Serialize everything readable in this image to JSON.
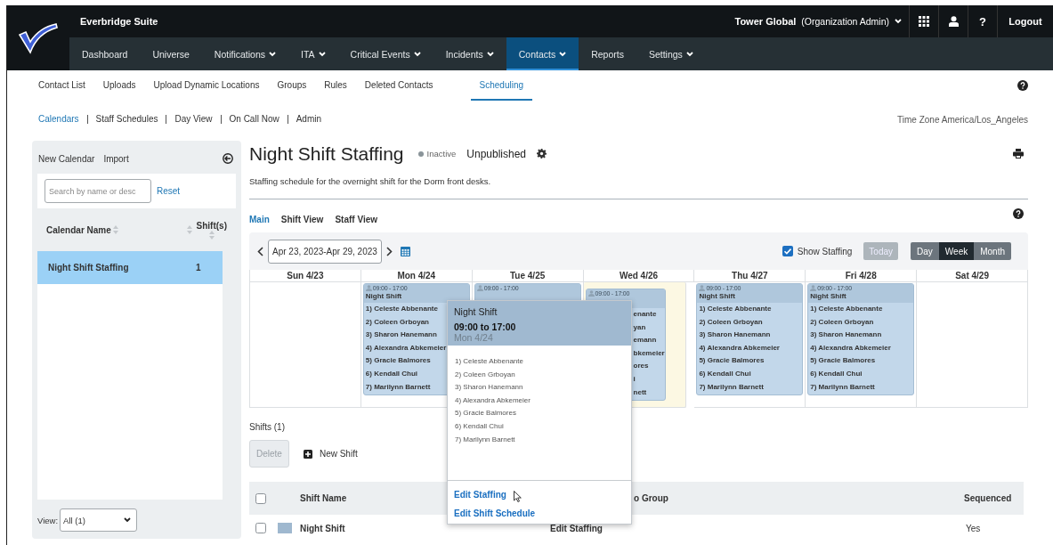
{
  "header": {
    "product": "Everbridge Suite",
    "organization": "Tower Global",
    "role": "(Organization Admin)",
    "help": "?",
    "logout": "Logout"
  },
  "nav": [
    {
      "label": "Dashboard",
      "menu": false,
      "selected": false
    },
    {
      "label": "Universe",
      "menu": false,
      "selected": false
    },
    {
      "label": "Notifications",
      "menu": true,
      "selected": false
    },
    {
      "label": "ITA",
      "menu": true,
      "selected": false
    },
    {
      "label": "Critical Events",
      "menu": true,
      "selected": false
    },
    {
      "label": "Incidents",
      "menu": true,
      "selected": false
    },
    {
      "label": "Contacts",
      "menu": true,
      "selected": true
    },
    {
      "label": "Reports",
      "menu": false,
      "selected": false
    },
    {
      "label": "Settings",
      "menu": true,
      "selected": false
    }
  ],
  "subnav": [
    {
      "label": "Contact List",
      "selected": false
    },
    {
      "label": "Uploads",
      "selected": false
    },
    {
      "label": "Upload Dynamic Locations",
      "selected": false
    },
    {
      "label": "Groups",
      "selected": false
    },
    {
      "label": "Rules",
      "selected": false
    },
    {
      "label": "Deleted Contacts",
      "selected": false
    },
    {
      "label": "Scheduling",
      "selected": true
    }
  ],
  "subtabs": [
    {
      "label": "Calendars",
      "selected": true
    },
    {
      "label": "Staff Schedules",
      "selected": false
    },
    {
      "label": "Day View",
      "selected": false
    },
    {
      "label": "On Call Now",
      "selected": false
    },
    {
      "label": "Admin",
      "selected": false
    }
  ],
  "timezone": "Time Zone America/Los_Angeles",
  "sidebar": {
    "actions": [
      "New Calendar",
      "Import"
    ],
    "search": {
      "placeholder": "Search by name or desc"
    },
    "reset": "Reset",
    "columns": [
      "Calendar Name",
      "Shift(s)"
    ],
    "rows": [
      {
        "name": "Night Shift Staffing",
        "shifts": "1",
        "selected": true
      }
    ],
    "view_label": "View:",
    "view_value": "All (1)"
  },
  "calendar": {
    "title": "Night Shift Staffing",
    "status": "Inactive",
    "publish": "Unpublished",
    "description": "Staffing schedule for the overnight shift for the Dorm front desks.",
    "tabs": [
      {
        "label": "Main",
        "selected": true
      },
      {
        "label": "Shift View",
        "selected": false
      },
      {
        "label": "Staff View",
        "selected": false
      }
    ],
    "date_range": "Apr 23, 2023-Apr 29, 2023",
    "show_staffing": {
      "label": "Show Staffing",
      "checked": true
    },
    "today_button": {
      "label": "Today",
      "disabled": true
    },
    "views": [
      {
        "label": "Day",
        "selected": false
      },
      {
        "label": "Week",
        "selected": true
      },
      {
        "label": "Month",
        "selected": false
      }
    ],
    "days": [
      {
        "label": "Sun 4/23",
        "today": false
      },
      {
        "label": "Mon 4/24",
        "today": false,
        "events": [
          {
            "kind": "full",
            "time": "09:00 - 17:00",
            "shift": "Night Shift",
            "staff": [
              "1) Celeste Abbenante",
              "2) Coleen Grboyan",
              "3) Sharon Hanemann",
              "4) Alexandra Abkemeier",
              "5) Gracie Balmores",
              "6) Kendall Chui",
              "7) Marilynn Barnett"
            ]
          }
        ]
      },
      {
        "label": "Tue 4/25",
        "today": false,
        "events": [
          {
            "kind": "partial",
            "time": "09:00 - 17:00"
          }
        ]
      },
      {
        "label": "Wed 4/26",
        "today": true,
        "events": [
          {
            "kind": "partial",
            "time": "09:00 - 17:00",
            "staff": [
              "enante",
              "yan",
              "emann",
              "bkemeier",
              "ores",
              "i",
              "nett"
            ]
          }
        ]
      },
      {
        "label": "Thu 4/27",
        "today": false,
        "events": [
          {
            "kind": "full",
            "time": "09:00 - 17:00",
            "shift": "Night Shift",
            "staff": [
              "1) Celeste Abbenante",
              "2) Coleen Grboyan",
              "3) Sharon Hanemann",
              "4) Alexandra Abkemeier",
              "5) Gracie Balmores",
              "6) Kendall Chui",
              "7) Marilynn Barnett"
            ]
          }
        ]
      },
      {
        "label": "Fri 4/28",
        "today": false,
        "events": [
          {
            "kind": "full",
            "time": "09:00 - 17:00",
            "shift": "Night Shift",
            "staff": [
              "1) Celeste Abbenante",
              "2) Coleen Grboyan",
              "3) Sharon Hanemann",
              "4) Alexandra Abkemeier",
              "5) Gracie Balmores",
              "6) Kendall Chui",
              "7) Marilynn Barnett"
            ]
          }
        ]
      },
      {
        "label": "Sat 4/29",
        "today": false
      }
    ]
  },
  "popup": {
    "shift": "Night Shift",
    "time": "09:00 to 17:00",
    "day": "Mon 4/24",
    "staff": [
      "1) Celeste Abbenante",
      "2) Coleen Grboyan",
      "3) Sharon Hanemann",
      "4) Alexandra Abkemeier",
      "5) Gracie Balmores",
      "6) Kendall Chui",
      "7) Marilynn Barnett"
    ],
    "links": [
      "Edit Staffing",
      "Edit Shift Schedule"
    ]
  },
  "shifts": {
    "heading": "Shifts (1)",
    "delete": {
      "label": "Delete",
      "disabled": true
    },
    "new_shift": "New Shift",
    "all_checked": false,
    "columns": [
      "Shift Name",
      "o Group",
      "Sequenced"
    ],
    "rows": [
      {
        "name": "Night Shift",
        "color": "#9fb8cf",
        "group": "Edit Staffing",
        "sequenced": "Yes",
        "checked": false
      }
    ]
  }
}
